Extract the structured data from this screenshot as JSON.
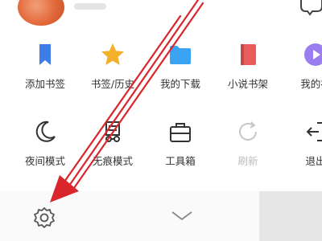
{
  "menu": {
    "row1": [
      {
        "label": "添加书签",
        "icon": "bookmark-add-icon",
        "color": "#3e7ce8"
      },
      {
        "label": "书签/历史",
        "icon": "star-icon",
        "color": "#f3b12c"
      },
      {
        "label": "我的下载",
        "icon": "folder-icon",
        "color": "#3aa3f2"
      },
      {
        "label": "小说书架",
        "icon": "book-icon",
        "color": "#e85c5c"
      },
      {
        "label": "我的视",
        "icon": "video-play-icon",
        "color": "#9a7ef0"
      }
    ],
    "row2": [
      {
        "label": "夜间模式",
        "icon": "moon-icon"
      },
      {
        "label": "无痕模式",
        "icon": "incognito-icon"
      },
      {
        "label": "工具箱",
        "icon": "toolbox-icon"
      },
      {
        "label": "刷新",
        "icon": "refresh-icon",
        "disabled": true
      },
      {
        "label": "退出",
        "icon": "exit-icon"
      }
    ]
  },
  "bottom": {
    "settings_icon": "gear-icon",
    "collapse_icon": "chevron-down-icon"
  },
  "colors": {
    "annotation_arrow": "#d9262c"
  }
}
